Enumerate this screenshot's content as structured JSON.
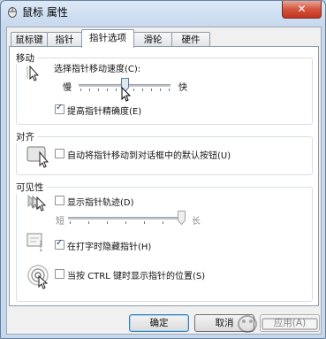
{
  "window": {
    "title": "鼠标 属性",
    "close_label": "✕"
  },
  "tabs": [
    {
      "label": "鼠标键",
      "active": false
    },
    {
      "label": "指针",
      "active": false
    },
    {
      "label": "指针选项",
      "active": true
    },
    {
      "label": "滑轮",
      "active": false
    },
    {
      "label": "硬件",
      "active": false
    }
  ],
  "motion": {
    "title": "移动",
    "speed_label": "选择指针移动速度(C):",
    "slow_label": "慢",
    "fast_label": "快",
    "speed_level": 0.5,
    "precision_label": "提高指针精确度(E)",
    "precision_checked": true
  },
  "snap": {
    "title": "对齐",
    "label": "自动将指针移动到对话框中的默认按钮(U)",
    "checked": false
  },
  "visibility": {
    "title": "可见性",
    "trails_label": "显示指针轨迹(D)",
    "trails_checked": false,
    "short_label": "短",
    "long_label": "长",
    "trails_level": 1.0,
    "hide_label": "在打字时隐藏指针(H)",
    "hide_checked": true,
    "ctrl_label": "当按 CTRL 键时显示指针的位置(S)",
    "ctrl_checked": false
  },
  "buttons": {
    "ok": "确定",
    "cancel": "取消",
    "apply": "应用(A)"
  },
  "colors": {
    "accent": "#3c7fb1",
    "close": "#c4331c"
  }
}
